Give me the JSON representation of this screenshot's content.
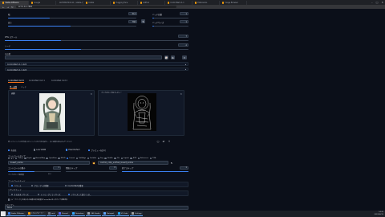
{
  "browser": {
    "tabs": [
      {
        "label": "Stable Diffusion",
        "active": true
      },
      {
        "label": "Google"
      },
      {
        "label": "AUTOMATIC1111 / stable-diffusion-webui"
      },
      {
        "label": "Civitai"
      },
      {
        "label": "Hugging Face"
      },
      {
        "label": "GitHub"
      },
      {
        "label": "ControlNet v1.1"
      },
      {
        "label": "Extensions"
      },
      {
        "label": "Image Browser"
      }
    ],
    "url": "127.0.0.1:7860",
    "window_controls": {
      "minimize": "–",
      "maximize": "□",
      "close": "✕"
    }
  },
  "params": {
    "width_label": "幅",
    "width_value": "512",
    "height_label": "高さ",
    "height_value": "768",
    "batch_count_label": "バッチ回数",
    "batch_count_value": "1",
    "batch_size_label": "バッチサイズ",
    "batch_size_value": "1",
    "swap_icon": "⇅",
    "cfg_label": "CFG スケール",
    "cfg_value": "7",
    "seed_label": "シード",
    "seed_value": "-1",
    "extra_label": "その他",
    "dice_icon": "🎲",
    "recycle_icon": "♻"
  },
  "controlnet": {
    "header": "ControlNet v1.1.224",
    "tabs": [
      "ControlNet Unit 0",
      "ControlNet Unit 1",
      "ControlNet Unit 2"
    ],
    "single_image_tab": "単一画像",
    "batch_tab": "バッチ",
    "image_label": "画像",
    "preview_label": "プリプロセッサのプレビュー",
    "note": "新しいキャンバスの作成にはキャンバスの寸法を設定し、白い画像を読み込んでください",
    "enable_label": "有効化",
    "lowvram_label": "Low VRAM",
    "pixel_perfect_label": "Pixel Perfect",
    "allow_preview_label": "プレビューを許可",
    "control_type_label": "コントロールタイプ",
    "control_types": [
      "全て",
      "Canny",
      "Depth",
      "NormalMap",
      "OpenPose",
      "MLSD",
      "Lineart",
      "SoftEdge",
      "Scribble",
      "Seg",
      "Shuffle",
      "Tile",
      "Inpaint",
      "IP2P",
      "Reference",
      "T2IA"
    ],
    "preprocessor_label": "プリプロセッサ",
    "preprocessor_value": "lineart_anime",
    "model_label": "モデル",
    "model_value": "control_v11p_sd15s2_lineart_anime",
    "weight_label": "コントロールの重み",
    "weight_value": "1",
    "start_label": "開始ステップ",
    "start_value": "0",
    "end_label": "終了ステップ",
    "end_value": "1",
    "resolution_label": "プリプロセッサ解像度",
    "resolution_value": "512",
    "control_mode_label": "コントロールモード",
    "control_modes": [
      "バランス",
      "プロンプトが重要",
      "ControlNetが重要"
    ],
    "resize_mode_label": "リサイズモード",
    "resize_modes": [
      "そのままリサイズ",
      "トリミングしてリサイズ",
      "リサイズして塗りつぶし"
    ],
    "loopback_label": "[ループバック] 生成された画像を次の反復のControlNetの入力として自動送信",
    "send_button": "送信",
    "run_icon": "💥",
    "close_icon": "✕"
  },
  "script": {
    "label": "スクリプト",
    "value": "None"
  },
  "taskbar": {
    "items": [
      {
        "label": "Stable Diffusion",
        "color": "#4285f4"
      },
      {
        "label": "エクスプローラー",
        "color": "#f59e0b"
      },
      {
        "label": "cmd",
        "color": "#6b7280"
      },
      {
        "label": "Discord",
        "color": "#5865f2"
      },
      {
        "label": "Photoshop",
        "color": "#31a8ff"
      },
      {
        "label": "OBS Studio",
        "color": "#9ca3af"
      },
      {
        "label": "Notepad",
        "color": "#60a5fa"
      },
      {
        "label": "VS Code",
        "color": "#22a6f2"
      },
      {
        "label": "Settings",
        "color": "#a3a3a3"
      }
    ],
    "time": "14:32",
    "date": "2023/06/15"
  }
}
